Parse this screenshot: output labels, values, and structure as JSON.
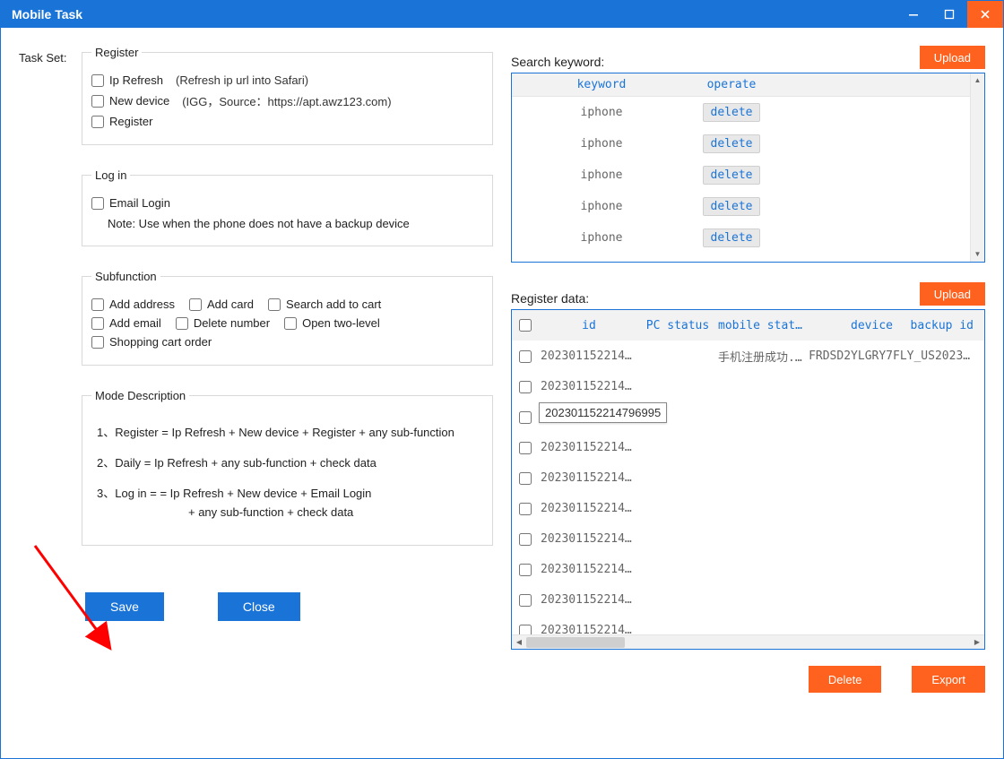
{
  "window": {
    "title": "Mobile Task"
  },
  "taskSetLabel": "Task Set:",
  "register": {
    "legend": "Register",
    "ipRefresh": "Ip Refresh",
    "ipRefreshHint": "(Refresh ip url into Safari)",
    "newDevice": "New device",
    "newDeviceHint": "(IGG，Source：https://apt.awz123.com)",
    "register": "Register"
  },
  "login": {
    "legend": "Log in",
    "emailLogin": "Email Login",
    "note": "Note: Use when the phone does not have a backup device"
  },
  "subfn": {
    "legend": "Subfunction",
    "addAddress": "Add address",
    "addCard": "Add card",
    "searchCart": "Search add to cart",
    "addEmail": "Add email",
    "delNumber": "Delete number",
    "openTwo": "Open two-level",
    "shopOrder": "Shopping cart order"
  },
  "modeDesc": {
    "legend": "Mode Description",
    "line1": "1、Register = Ip Refresh + New device + Register + any sub-function",
    "line2": "2、Daily =   Ip Refresh + any sub-function + check data",
    "line3a": "3、Log in =  = Ip Refresh + New device + Email Login",
    "line3b": "+ any sub-function + check data"
  },
  "buttons": {
    "save": "Save",
    "close": "Close",
    "upload": "Upload",
    "delete": "Delete",
    "export": "Export"
  },
  "keyword": {
    "label": "Search keyword:",
    "hdrKeyword": "keyword",
    "hdrOperate": "operate",
    "deleteBtn": "delete",
    "rows": [
      "iphone",
      "iphone",
      "iphone",
      "iphone",
      "iphone"
    ]
  },
  "regdata": {
    "label": "Register data:",
    "hdr": {
      "id": "id",
      "pc": "PC status",
      "mob": "mobile status",
      "dev": "device",
      "bak": "backup id"
    },
    "rows": [
      {
        "id": "202301152214...",
        "pc": "",
        "mob": "手机注册成功...",
        "dev": "FRDSD2YLGRY7",
        "bak": "FLY_US202301..."
      },
      {
        "id": "202301152214..."
      },
      {
        "id": "202301152214..."
      },
      {
        "id": "202301152214..."
      },
      {
        "id": "202301152214..."
      },
      {
        "id": "202301152214..."
      },
      {
        "id": "202301152214..."
      },
      {
        "id": "202301152214..."
      },
      {
        "id": "202301152214..."
      },
      {
        "id": "202301152214..."
      }
    ],
    "tooltip": "202301152214796995"
  }
}
